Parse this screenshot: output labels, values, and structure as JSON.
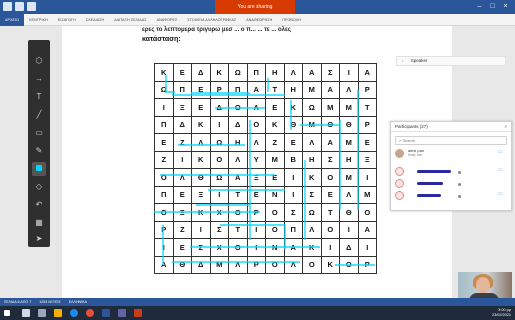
{
  "window": {
    "share_banner": "You are sharing"
  },
  "ribbon": {
    "tabs": [
      "ΑΡΧΕΙΟ",
      "ΚΕΝΤΡΙΚΗ",
      "ΕΙΣΑΓΩΓΗ",
      "ΣΧΕΔΙΑΣΗ",
      "ΔΙΑΤΑΞΗ ΣΕΛΙΔΑΣ",
      "ΑΝΑΦΟΡΕΣ",
      "ΣΤΟΙΧΕΙΑ ΑΛΛΗΛΟΓΡΑΦΙΑΣ",
      "ΑΝΑΘΕΩΡΗΣΗ",
      "ΠΡΟΒΟΛΗ"
    ],
    "active_tab": 0
  },
  "document": {
    "heading_line_1": "ερες το λεπτομερα τριγυρω μεσ ... ο π... ... τε ... ολες",
    "heading_line_2": "κατάσταση:"
  },
  "grid": {
    "rows": [
      [
        "Κ",
        "Ε",
        "Δ",
        "Κ",
        "Ω",
        "Π",
        "Η",
        "Λ",
        "Α",
        "Σ",
        "Ι",
        "Α"
      ],
      [
        "Ω",
        "Π",
        "Ε",
        "Ρ",
        "Π",
        "Α",
        "Τ",
        "Η",
        "Μ",
        "Α",
        "Λ",
        "Ρ"
      ],
      [
        "Ι",
        "Ξ",
        "Ε",
        "Δ",
        "Ο",
        "Λ",
        "Ε",
        "Κ",
        "Ω",
        "Μ",
        "Μ",
        "Τ"
      ],
      [
        "Π",
        "Δ",
        "Κ",
        "Ι",
        "Δ",
        "Ο",
        "Κ",
        "Θ",
        "Μ",
        "Θ",
        "Θ",
        "Ρ"
      ],
      [
        "Ε",
        "Ζ",
        "Λ",
        "Ω",
        "Η",
        "Λ",
        "Ζ",
        "Ε",
        "Λ",
        "Α",
        "Μ",
        "Ε"
      ],
      [
        "Ζ",
        "Ι",
        "Κ",
        "Ο",
        "Λ",
        "Υ",
        "Μ",
        "Β",
        "Η",
        "Σ",
        "Η",
        "Ξ"
      ],
      [
        "Ο",
        "Λ",
        "Θ",
        "Ω",
        "Α",
        "Ξ",
        "Ε",
        "Ι",
        "Κ",
        "Ο",
        "Μ",
        "Ι"
      ],
      [
        "Π",
        "Ε",
        "Ξ",
        "Ι",
        "Τ",
        "Ε",
        "Ν",
        "Ι",
        "Σ",
        "Ε",
        "Λ",
        "Μ"
      ],
      [
        "Ο",
        "Ξ",
        "Κ",
        "Χ",
        "Ο",
        "Ρ",
        "Ο",
        "Σ",
        "Ω",
        "Τ",
        "Θ",
        "Ο"
      ],
      [
        "Ρ",
        "Ζ",
        "Ι",
        "Σ",
        "Τ",
        "Ι",
        "Ο",
        "Π",
        "Λ",
        "Ο",
        "Ι",
        "Α"
      ],
      [
        "Ι",
        "Ε",
        "Σ",
        "Χ",
        "Ο",
        "Ι",
        "Ν",
        "Α",
        "Κ",
        "Ι",
        "Δ",
        "Ι"
      ],
      [
        "Α",
        "Θ",
        "Δ",
        "Μ",
        "Λ",
        "Ρ",
        "Ο",
        "Λ",
        "Ο",
        "Κ",
        "Ο",
        "Ρ"
      ]
    ]
  },
  "pen_toolbar": {
    "icons": [
      "lasso-icon",
      "arrow-icon",
      "text-icon",
      "highlighter-icon",
      "eraser-icon",
      "pen-icon",
      "color-swatch-icon",
      "shape-icon",
      "undo-icon",
      "redo-icon",
      "grid-icon",
      "pointer-icon"
    ],
    "active_color": "#00d7ff"
  },
  "speaker": {
    "label": "Speaker"
  },
  "participants": {
    "title": "Participants (27)",
    "search_placeholder": "Search",
    "self_name": "alexi pan",
    "self_role": "Host, me"
  },
  "statusbar": {
    "items": [
      "ΣΕΛΙΔΑ 6 ΑΠΟ 7",
      "1253 ΛΕΞΕΙΣ",
      "ΕΛΛΗΝΙΚΑ"
    ]
  },
  "tray": {
    "time": "3:00 μμ",
    "date": "23/02/2021"
  },
  "colors": {
    "accent": "#2b579a",
    "highlight": "#00d7ff",
    "banner": "#d83b01"
  }
}
